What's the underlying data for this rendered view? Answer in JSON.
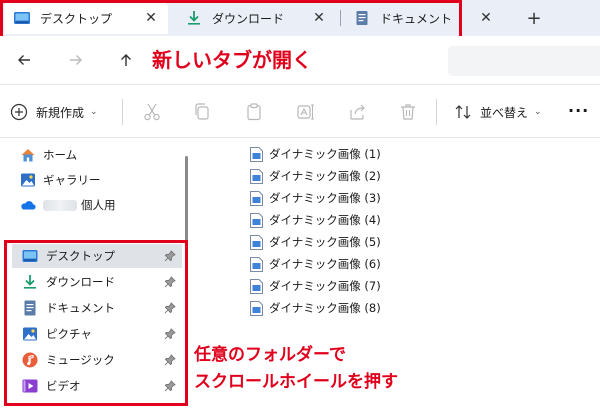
{
  "tabs": [
    {
      "label": "デスクトップ",
      "close": "✕"
    },
    {
      "label": "ダウンロード",
      "close": "✕"
    },
    {
      "label": "ドキュメント"
    }
  ],
  "tab_bar": {
    "standalone_close": "✕",
    "new_tab": "+"
  },
  "annotations": {
    "top": "新しいタブが開く",
    "bottom_line1": "任意のフォルダーで",
    "bottom_line2": "スクロールホイールを押す",
    "color": "#e0001b"
  },
  "toolbar": {
    "new_label": "新規作成",
    "new_chevron": "⌄",
    "sort_label": "並べ替え",
    "sort_chevron": "⌄",
    "more": "···"
  },
  "sidebar": {
    "top_items": [
      {
        "label": "ホーム",
        "icon": "home-icon"
      },
      {
        "label": "ギャラリー",
        "icon": "gallery-icon"
      },
      {
        "label": "個人用",
        "icon": "onedrive-cloud-icon"
      }
    ],
    "pinned": [
      {
        "label": "デスクトップ",
        "icon": "desktop-icon",
        "selected": true
      },
      {
        "label": "ダウンロード",
        "icon": "download-icon"
      },
      {
        "label": "ドキュメント",
        "icon": "document-icon"
      },
      {
        "label": "ピクチャ",
        "icon": "pictures-icon"
      },
      {
        "label": "ミュージック",
        "icon": "music-icon"
      },
      {
        "label": "ビデオ",
        "icon": "video-icon"
      }
    ]
  },
  "files": [
    "ダイナミック画像 (1)",
    "ダイナミック画像 (2)",
    "ダイナミック画像 (3)",
    "ダイナミック画像 (4)",
    "ダイナミック画像 (5)",
    "ダイナミック画像 (6)",
    "ダイナミック画像 (7)",
    "ダイナミック画像 (8)"
  ],
  "colors": {
    "accent": "#0a64c8",
    "tab_bar": "#e9eef7",
    "selection": "#dfe3e8"
  }
}
